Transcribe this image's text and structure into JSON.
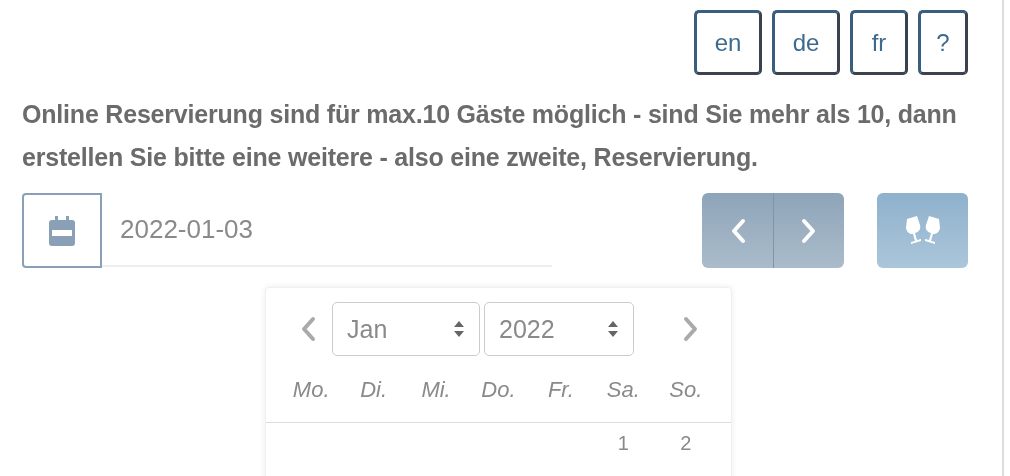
{
  "languages": [
    {
      "label": "en"
    },
    {
      "label": "de"
    },
    {
      "label": "fr"
    },
    {
      "label": "?"
    }
  ],
  "notice": "Online Reservierung sind für max.10 Gäste möglich - sind Sie mehr als 10, dann erstellen Sie bitte eine weitere - also eine zweite, Reservierung.",
  "date_field": {
    "value": "2022-01-03"
  },
  "datepicker": {
    "month": "Jan",
    "year": "2022",
    "weekdays": [
      "Mo.",
      "Di.",
      "Mi.",
      "Do.",
      "Fr.",
      "Sa.",
      "So."
    ],
    "days": [
      "1",
      "2"
    ]
  }
}
